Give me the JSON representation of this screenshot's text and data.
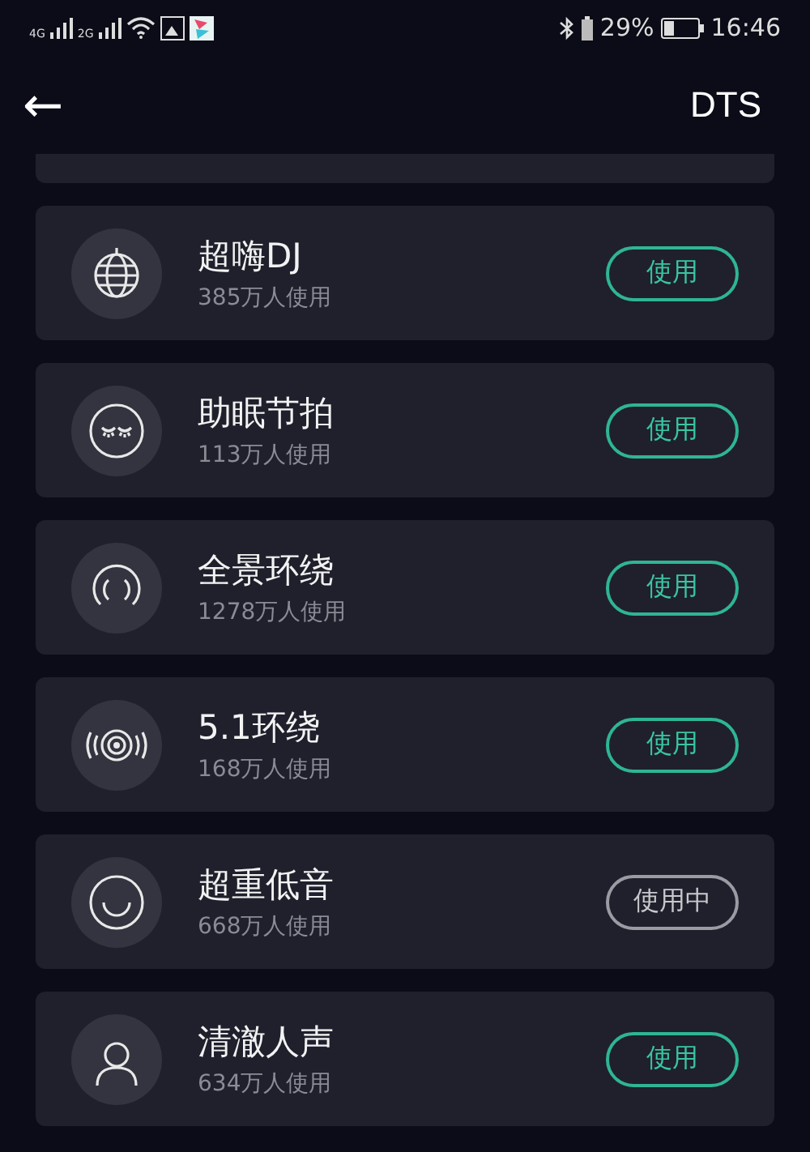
{
  "status_bar": {
    "network_1": "4G",
    "network_2": "2G",
    "battery": "29%",
    "time": "16:46"
  },
  "header": {
    "back": "←",
    "title": "DTS"
  },
  "effects": [
    {
      "kind": "globe",
      "name": "超嗨DJ",
      "users": "385万人使用",
      "action": "使用",
      "selected": false
    },
    {
      "kind": "sleep",
      "name": "助眠节拍",
      "users": "113万人使用",
      "action": "使用",
      "selected": false
    },
    {
      "kind": "surround",
      "name": "全景环绕",
      "users": "1278万人使用",
      "action": "使用",
      "selected": false
    },
    {
      "kind": "speaker",
      "name": "5.1环绕",
      "users": "168万人使用",
      "action": "使用",
      "selected": false
    },
    {
      "kind": "smile",
      "name": "超重低音",
      "users": "668万人使用",
      "action": "使用中",
      "selected": true
    },
    {
      "kind": "person",
      "name": "清澈人声",
      "users": "634万人使用",
      "action": "使用",
      "selected": false
    }
  ]
}
